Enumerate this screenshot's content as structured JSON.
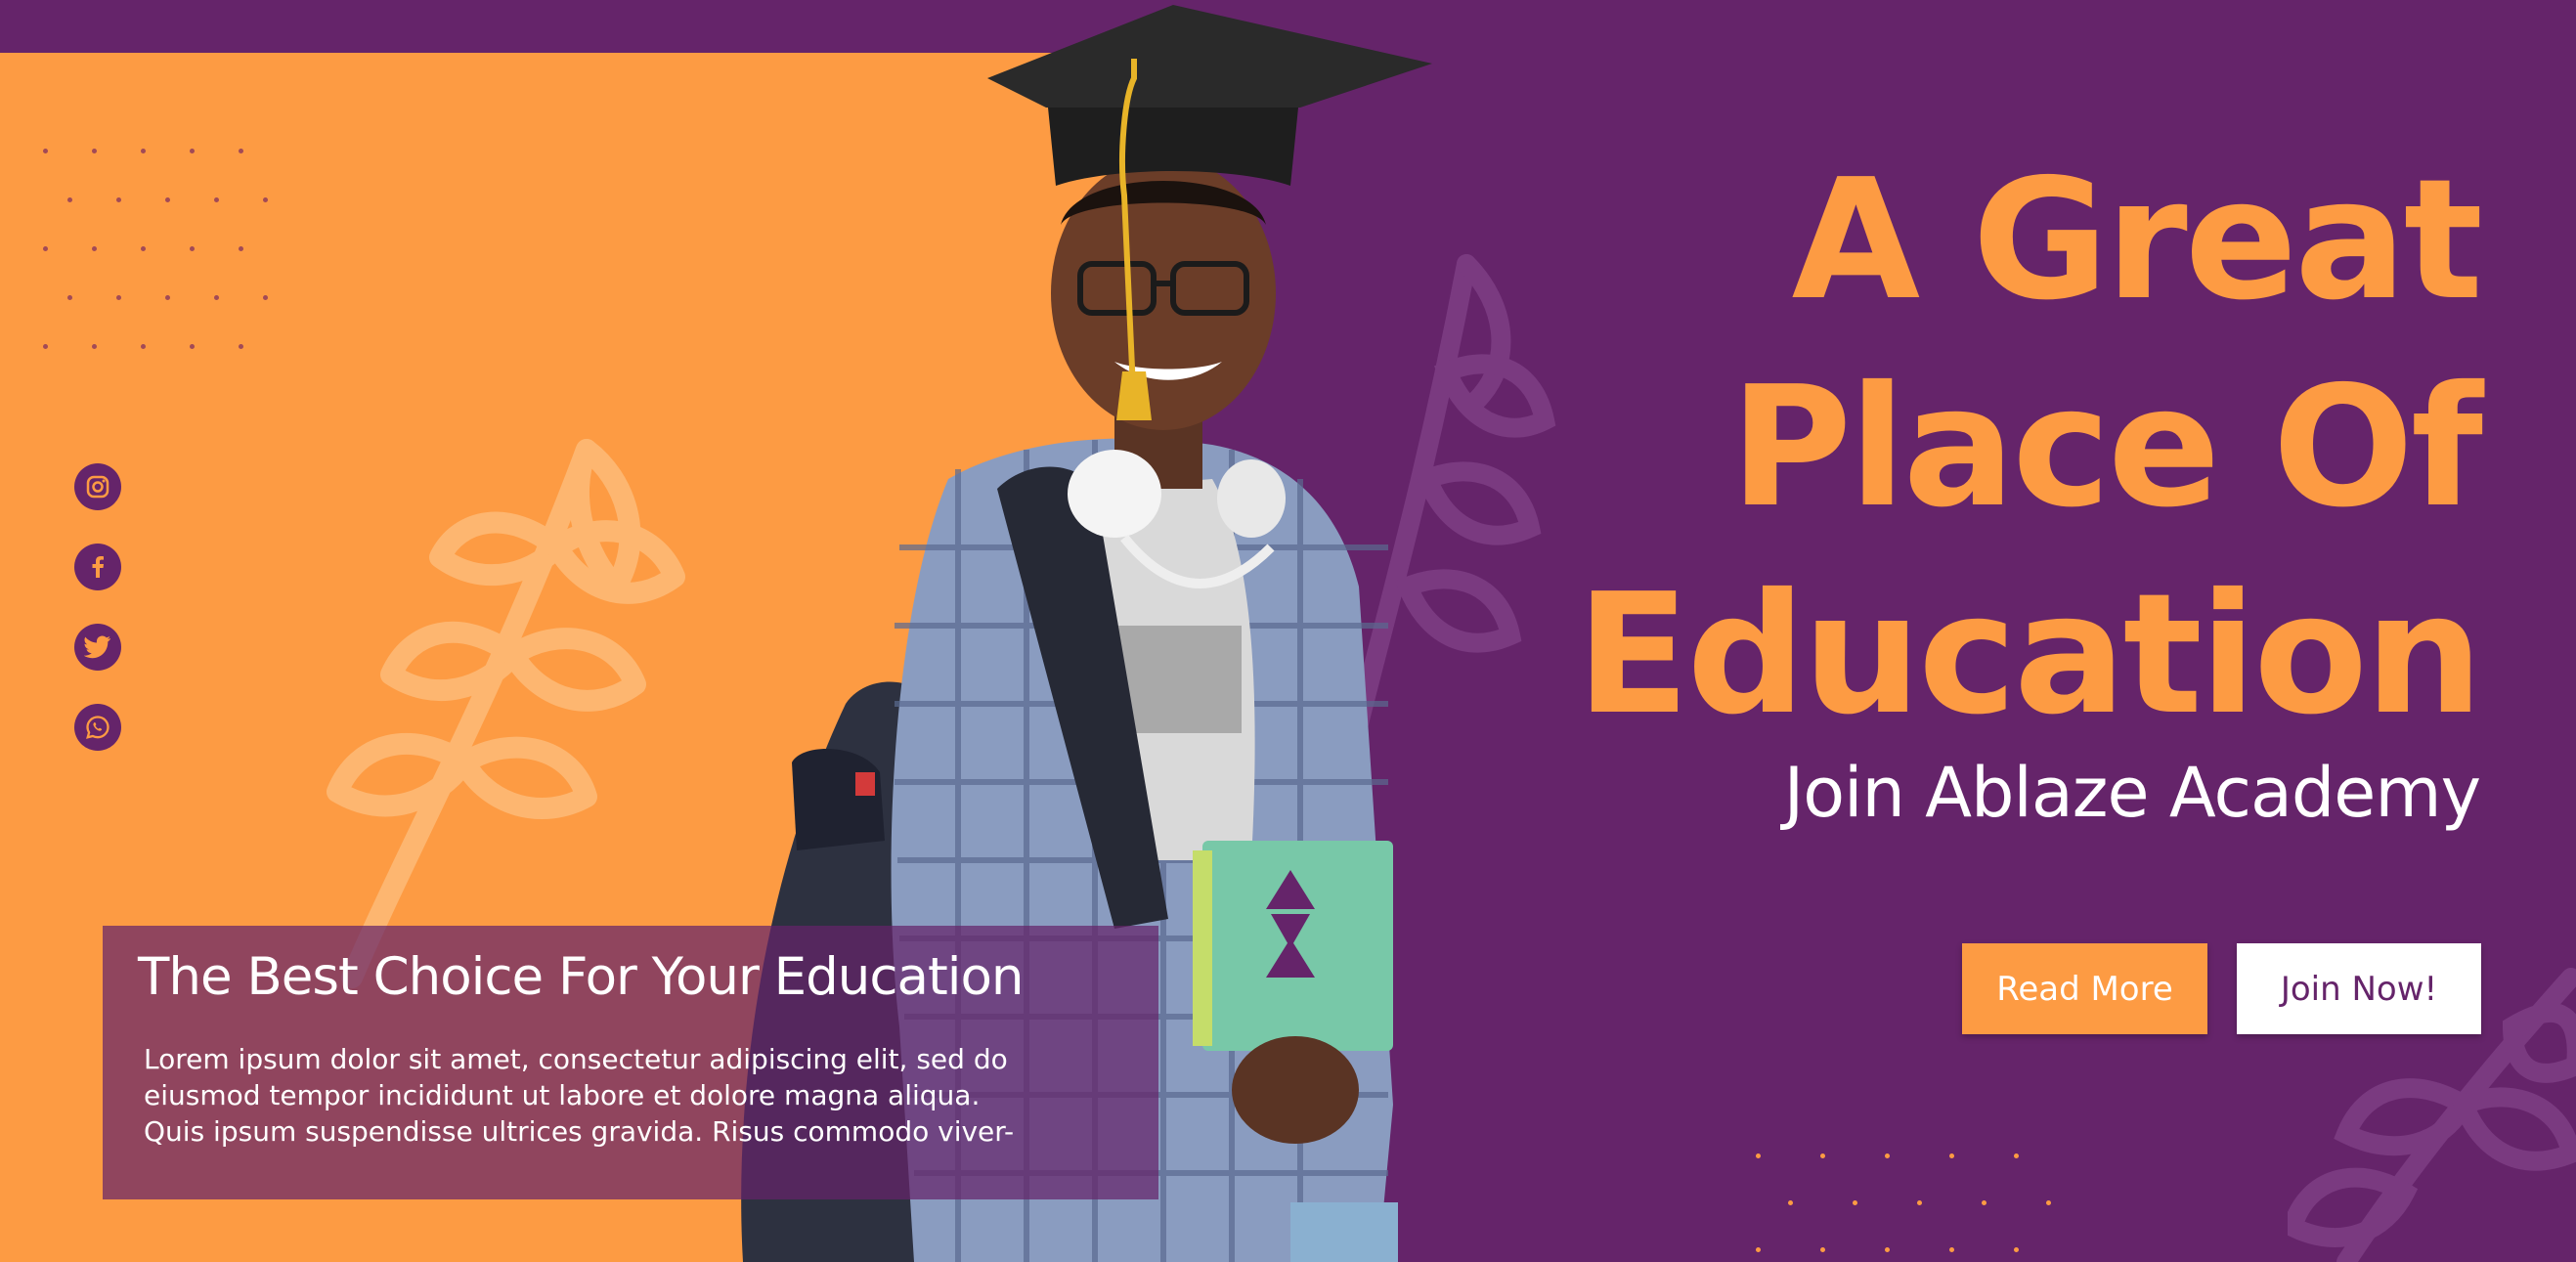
{
  "colors": {
    "purple": "#65246a",
    "orange": "#fd9b43",
    "white": "#ffffff"
  },
  "hero": {
    "headline_lines": [
      "A Great",
      "Place Of",
      "Education"
    ],
    "subheadline": "Join Ablaze Academy"
  },
  "buttons": {
    "read_more": "Read More",
    "join_now": "Join Now!"
  },
  "info_box": {
    "title": "The Best Choice For Your Education",
    "body_lines": [
      "Lorem ipsum dolor sit amet, consectetur adipiscing elit, sed do",
      "eiusmod tempor incididunt ut labore et dolore magna aliqua.",
      "Quis ipsum suspendisse ultrices gravida. Risus commodo viver-"
    ]
  },
  "social_icons": [
    "instagram-icon",
    "facebook-icon",
    "twitter-icon",
    "whatsapp-icon"
  ]
}
